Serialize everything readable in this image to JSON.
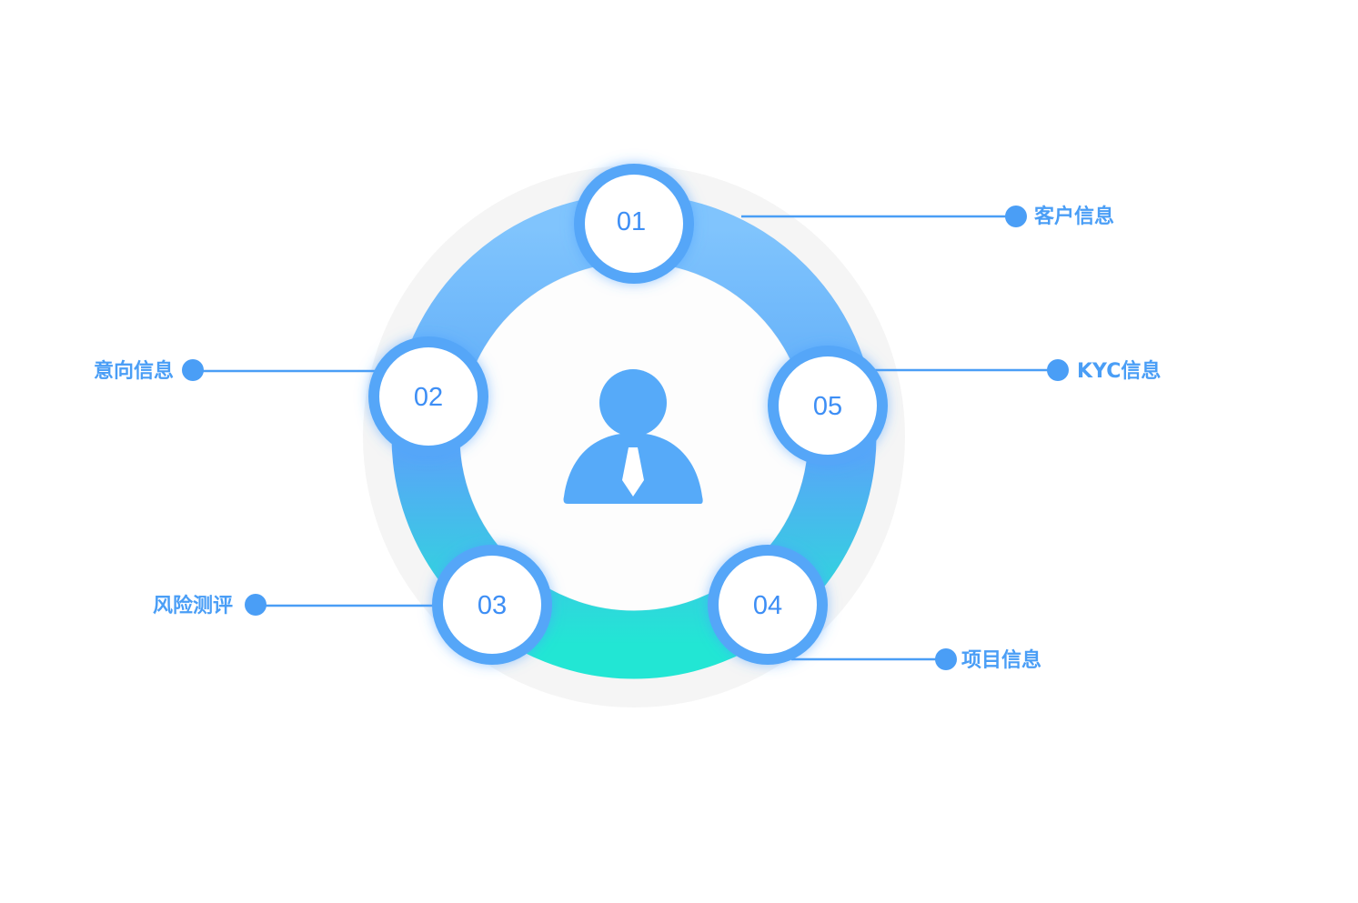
{
  "colors": {
    "ring_top": "#80c4fd",
    "ring_mid": "#57a7f7",
    "ring_bottom": "#22e6d4",
    "accent": "#4a9ef6",
    "node_border": "#55a6f8",
    "node_text": "#3c8ef5",
    "halo": "#f5f5f5",
    "person_icon": "#56aaf9"
  },
  "center": {
    "icon": "person-with-tie-icon"
  },
  "nodes": [
    {
      "id": "01",
      "label": "01",
      "callout": "客户信息"
    },
    {
      "id": "02",
      "label": "02",
      "callout": "意向信息"
    },
    {
      "id": "03",
      "label": "03",
      "callout": "风险测评"
    },
    {
      "id": "04",
      "label": "04",
      "callout": "项目信息"
    },
    {
      "id": "05",
      "label": "05",
      "callout": "KYC信息"
    }
  ]
}
